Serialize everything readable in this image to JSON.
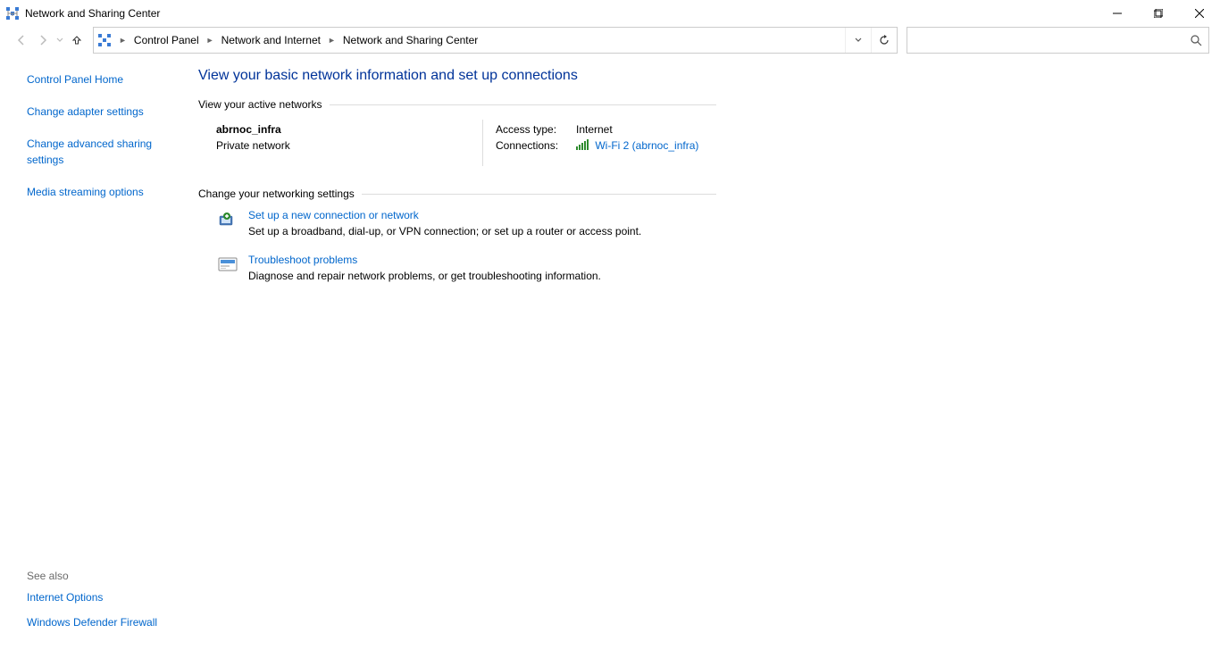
{
  "window": {
    "title": "Network and Sharing Center"
  },
  "breadcrumbs": {
    "item1": "Control Panel",
    "item2": "Network and Internet",
    "item3": "Network and Sharing Center"
  },
  "search": {
    "placeholder": ""
  },
  "sidebar": {
    "home": "Control Panel Home",
    "link1": "Change adapter settings",
    "link2": "Change advanced sharing settings",
    "link3": "Media streaming options",
    "seealso_heading": "See also",
    "seealso1": "Internet Options",
    "seealso2": "Windows Defender Firewall"
  },
  "main": {
    "heading": "View your basic network information and set up connections",
    "section_active": "View your active networks",
    "network": {
      "name": "abrnoc_infra",
      "type": "Private network",
      "access_label": "Access type:",
      "access_value": "Internet",
      "conn_label": "Connections:",
      "conn_link": "Wi-Fi 2 (abrnoc_infra)"
    },
    "section_change": "Change your networking settings",
    "item1": {
      "title": "Set up a new connection or network",
      "desc": "Set up a broadband, dial-up, or VPN connection; or set up a router or access point."
    },
    "item2": {
      "title": "Troubleshoot problems",
      "desc": "Diagnose and repair network problems, or get troubleshooting information."
    }
  }
}
